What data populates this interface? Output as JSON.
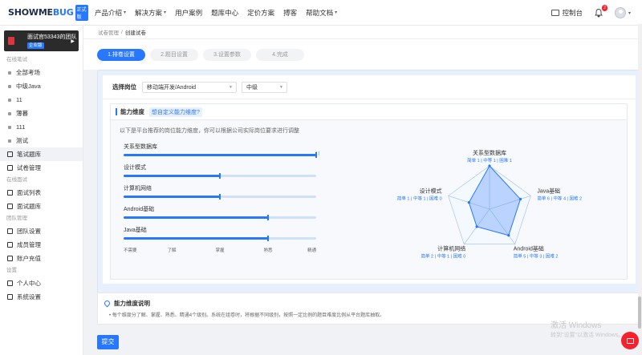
{
  "topbar": {
    "logo_main": "SHOWME",
    "logo_accent": "BUG",
    "logo_badge": "正式版",
    "nav": [
      {
        "label": "产品介绍",
        "caret": true
      },
      {
        "label": "解决方案",
        "caret": true
      },
      {
        "label": "用户案例",
        "caret": false
      },
      {
        "label": "题库中心",
        "caret": false
      },
      {
        "label": "定价方案",
        "caret": false
      },
      {
        "label": "搏客",
        "caret": false
      },
      {
        "label": "帮助文档",
        "caret": true
      }
    ],
    "console_label": "控制台",
    "notification_count": "2"
  },
  "sidebar": {
    "team_name": "面试官53343的团队",
    "team_tag": "企业版",
    "groups": [
      {
        "title": "在线笔试",
        "items": [
          {
            "label": "全部考场",
            "icon": "dot",
            "active": false
          },
          {
            "label": "中级Java",
            "icon": "dot",
            "active": false
          },
          {
            "label": "11",
            "icon": "dot",
            "active": false
          },
          {
            "label": "薄暮",
            "icon": "dot",
            "active": false
          },
          {
            "label": "111",
            "icon": "dot",
            "active": false
          },
          {
            "label": "测试",
            "icon": "dot",
            "active": false
          },
          {
            "label": "笔试题库",
            "icon": "book",
            "active": true
          },
          {
            "label": "试卷管理",
            "icon": "paper",
            "active": false
          }
        ]
      },
      {
        "title": "在线面试",
        "items": [
          {
            "label": "面试列表",
            "icon": "list",
            "active": false
          },
          {
            "label": "面试题库",
            "icon": "grid",
            "active": false
          }
        ]
      },
      {
        "title": "团队管理",
        "items": [
          {
            "label": "团队设置",
            "icon": "team",
            "active": false
          },
          {
            "label": "成员管理",
            "icon": "member",
            "active": false
          },
          {
            "label": "账户充值",
            "icon": "wallet",
            "active": false
          }
        ]
      },
      {
        "title": "设置",
        "items": [
          {
            "label": "个人中心",
            "icon": "user",
            "active": false
          },
          {
            "label": "系统设置",
            "icon": "gear",
            "active": false
          }
        ]
      }
    ]
  },
  "breadcrumb": {
    "parent": "试卷管理",
    "sep": "/",
    "current": "创建试卷"
  },
  "steps": [
    "1.排卷设置",
    "2.题目设置",
    "3.设置参数",
    "4.完成"
  ],
  "position": {
    "label": "选择岗位",
    "role": "移动端开发/Android",
    "level": "中级"
  },
  "ability": {
    "title": "能力维度",
    "custom_link": "想自定义能力维度?",
    "hint": "以下是平台推荐的岗位能力维度，你可以根据公司实际岗位要求进行调整",
    "scale_labels": [
      "不需要",
      "了解",
      "掌握",
      "熟悉",
      "精通"
    ],
    "dimensions": [
      {
        "name": "关系型数据库",
        "level": 1.0,
        "detail": "简单 1 | 中等 1 | 困难 1"
      },
      {
        "name": "设计模式",
        "level": 0.5,
        "detail": "简单 1 | 中等 1 | 困难 0"
      },
      {
        "name": "计算机网络",
        "level": 0.5,
        "detail": "简单 2 | 中等 1 | 困难 0"
      },
      {
        "name": "Android基础",
        "level": 0.75,
        "detail": "简单 5 | 中等 3 | 困难 2"
      },
      {
        "name": "Java基础",
        "level": 0.75,
        "detail": "简单 6 | 中等 4 | 困难 2"
      }
    ],
    "end_mark": "| |"
  },
  "note": {
    "title": "能力维度说明",
    "text": "• 每个维度分了解、掌握、熟悉、精通4个级别。系统在组卷时，将根据不同级别，按照一定比例的题目难度比例从平台题库抽取。"
  },
  "submit_label": "提交",
  "watermark": {
    "line1": "激活 Windows",
    "line2": "转到\"设置\"以激活 Windows。"
  },
  "colors": {
    "primary": "#2878ff",
    "light_track": "#cfe0fb",
    "badge_red": "#f5222d"
  }
}
